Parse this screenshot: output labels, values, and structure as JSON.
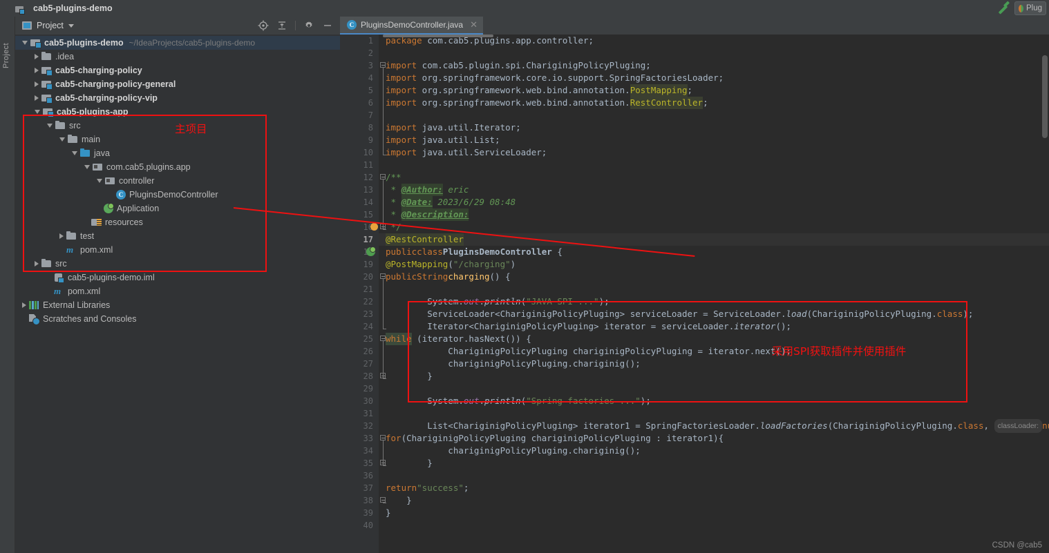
{
  "window": {
    "title": "cab5-plugins-demo",
    "app_icon": "module-icon",
    "build_icon": "hammer-icon",
    "run_config_label": "Plug",
    "run_config_icon": "spring-boot-icon"
  },
  "left_stripe": {
    "vertical_tab": "Project"
  },
  "project_panel": {
    "view_name": "Project",
    "view_icon": "project-view-icon",
    "dropdown_icon": "chevron-down-icon",
    "toolbar": [
      {
        "name": "locate-icon",
        "title": "Select Opened File"
      },
      {
        "name": "collapse-all-icon",
        "title": "Collapse All"
      },
      {
        "name": "gear-icon",
        "title": "Settings"
      },
      {
        "name": "minimize-icon",
        "title": "Hide"
      }
    ],
    "tree": [
      {
        "label": "cab5-plugins-demo",
        "sub": "~/IdeaProjects/cab5-plugins-demo",
        "indent": 0,
        "arrow": "down",
        "icon": "module-folder-icon",
        "bold": true,
        "selected": true
      },
      {
        "label": ".idea",
        "sub": "",
        "indent": 1,
        "arrow": "right",
        "icon": "folder-icon",
        "bold": false,
        "selected": false
      },
      {
        "label": "cab5-charging-policy",
        "sub": "",
        "indent": 1,
        "arrow": "right",
        "icon": "module-folder-icon",
        "bold": true,
        "selected": false
      },
      {
        "label": "cab5-charging-policy-general",
        "sub": "",
        "indent": 1,
        "arrow": "right",
        "icon": "module-folder-icon",
        "bold": true,
        "selected": false
      },
      {
        "label": "cab5-charging-policy-vip",
        "sub": "",
        "indent": 1,
        "arrow": "right",
        "icon": "module-folder-icon",
        "bold": true,
        "selected": false
      },
      {
        "label": "cab5-plugins-app",
        "sub": "",
        "indent": 1,
        "arrow": "down",
        "icon": "module-folder-icon",
        "bold": true,
        "selected": false
      },
      {
        "label": "src",
        "sub": "",
        "indent": 2,
        "arrow": "down",
        "icon": "folder-icon",
        "bold": false,
        "selected": false
      },
      {
        "label": "main",
        "sub": "",
        "indent": 3,
        "arrow": "down",
        "icon": "folder-icon",
        "bold": false,
        "selected": false
      },
      {
        "label": "java",
        "sub": "",
        "indent": 4,
        "arrow": "down",
        "icon": "source-folder-icon",
        "bold": false,
        "selected": false
      },
      {
        "label": "com.cab5.plugins.app",
        "sub": "",
        "indent": 5,
        "arrow": "down",
        "icon": "package-icon",
        "bold": false,
        "selected": false
      },
      {
        "label": "controller",
        "sub": "",
        "indent": 6,
        "arrow": "down",
        "icon": "package-icon",
        "bold": false,
        "selected": false
      },
      {
        "label": "PluginsDemoController",
        "sub": "",
        "indent": 7,
        "arrow": "none",
        "icon": "java-class-icon",
        "bold": false,
        "selected": false
      },
      {
        "label": "Application",
        "sub": "",
        "indent": 6,
        "arrow": "none",
        "icon": "spring-boot-class-icon",
        "bold": false,
        "selected": false
      },
      {
        "label": "resources",
        "sub": "",
        "indent": 5,
        "arrow": "none",
        "icon": "resources-folder-icon",
        "bold": false,
        "selected": false
      },
      {
        "label": "test",
        "sub": "",
        "indent": 3,
        "arrow": "right",
        "icon": "folder-icon",
        "bold": false,
        "selected": false
      },
      {
        "label": "pom.xml",
        "sub": "",
        "indent": 3,
        "arrow": "none",
        "icon": "maven-icon",
        "bold": false,
        "selected": false
      },
      {
        "label": "src",
        "sub": "",
        "indent": 1,
        "arrow": "right",
        "icon": "folder-icon",
        "bold": false,
        "selected": false
      },
      {
        "label": "cab5-plugins-demo.iml",
        "sub": "",
        "indent": 2,
        "arrow": "none",
        "icon": "iml-icon",
        "bold": false,
        "selected": false
      },
      {
        "label": "pom.xml",
        "sub": "",
        "indent": 2,
        "arrow": "none",
        "icon": "maven-icon",
        "bold": false,
        "selected": false
      },
      {
        "label": "External Libraries",
        "sub": "",
        "indent": 0,
        "arrow": "right",
        "icon": "libraries-icon",
        "bold": false,
        "selected": false
      },
      {
        "label": "Scratches and Consoles",
        "sub": "",
        "indent": 0,
        "arrow": "none",
        "icon": "scratches-icon",
        "bold": false,
        "selected": false
      }
    ]
  },
  "editor": {
    "tab": {
      "label": "PluginsDemoController.java",
      "icon": "java-class-icon",
      "close_icon": "close-icon"
    },
    "current_line": 17,
    "lines": [
      {
        "n": 1,
        "text": "package com.cab5.plugins.app.controller;"
      },
      {
        "n": 2,
        "text": ""
      },
      {
        "n": 3,
        "text": "import com.cab5.plugin.spi.ChariginigPolicyPluging;"
      },
      {
        "n": 4,
        "text": "import org.springframework.core.io.support.SpringFactoriesLoader;"
      },
      {
        "n": 5,
        "text": "import org.springframework.web.bind.annotation.PostMapping;"
      },
      {
        "n": 6,
        "text": "import org.springframework.web.bind.annotation.RestController;"
      },
      {
        "n": 7,
        "text": ""
      },
      {
        "n": 8,
        "text": "import java.util.Iterator;"
      },
      {
        "n": 9,
        "text": "import java.util.List;"
      },
      {
        "n": 10,
        "text": "import java.util.ServiceLoader;"
      },
      {
        "n": 11,
        "text": ""
      },
      {
        "n": 12,
        "text": "/**"
      },
      {
        "n": 13,
        "text": " * @Author: eric"
      },
      {
        "n": 14,
        "text": " * @Date: 2023/6/29 08:48"
      },
      {
        "n": 15,
        "text": " * @Description:"
      },
      {
        "n": 16,
        "text": " */"
      },
      {
        "n": 17,
        "text": "@RestController"
      },
      {
        "n": 18,
        "text": "public class PluginsDemoController {"
      },
      {
        "n": 19,
        "text": "    @PostMapping(\"/charging\")"
      },
      {
        "n": 20,
        "text": "    public String charging() {"
      },
      {
        "n": 21,
        "text": ""
      },
      {
        "n": 22,
        "text": "        System.out.println(\"JAVA SPI ...\");"
      },
      {
        "n": 23,
        "text": "        ServiceLoader<ChariginigPolicyPluging> serviceLoader = ServiceLoader.load(ChariginigPolicyPluging.class);"
      },
      {
        "n": 24,
        "text": "        Iterator<ChariginigPolicyPluging> iterator = serviceLoader.iterator();"
      },
      {
        "n": 25,
        "text": "        while (iterator.hasNext()) {"
      },
      {
        "n": 26,
        "text": "            ChariginigPolicyPluging chariginigPolicyPluging = iterator.next();"
      },
      {
        "n": 27,
        "text": "            chariginigPolicyPluging.chariginig();"
      },
      {
        "n": 28,
        "text": "        }"
      },
      {
        "n": 29,
        "text": ""
      },
      {
        "n": 30,
        "text": "        System.out.println(\"Spring factories ...\");"
      },
      {
        "n": 31,
        "text": ""
      },
      {
        "n": 32,
        "text": "        List<ChariginigPolicyPluging> iterator1 = SpringFactoriesLoader.loadFactories(ChariginigPolicyPluging.class, classLoader: null);"
      },
      {
        "n": 33,
        "text": "        for(ChariginigPolicyPluging chariginigPolicyPluging : iterator1){"
      },
      {
        "n": 34,
        "text": "            chariginigPolicyPluging.chariginig();"
      },
      {
        "n": 35,
        "text": "        }"
      },
      {
        "n": 36,
        "text": ""
      },
      {
        "n": 37,
        "text": "        return \"success\";"
      },
      {
        "n": 38,
        "text": "    }"
      },
      {
        "n": 39,
        "text": "}"
      },
      {
        "n": 40,
        "text": ""
      }
    ],
    "inlay_hint": "classLoader:"
  },
  "annotations": {
    "main_project_label": "主项目",
    "spi_label": "采用SPI获取插件并使用插件",
    "box_color": "#ee1111",
    "text_color": "#f31111"
  },
  "watermark": "CSDN @cab5"
}
